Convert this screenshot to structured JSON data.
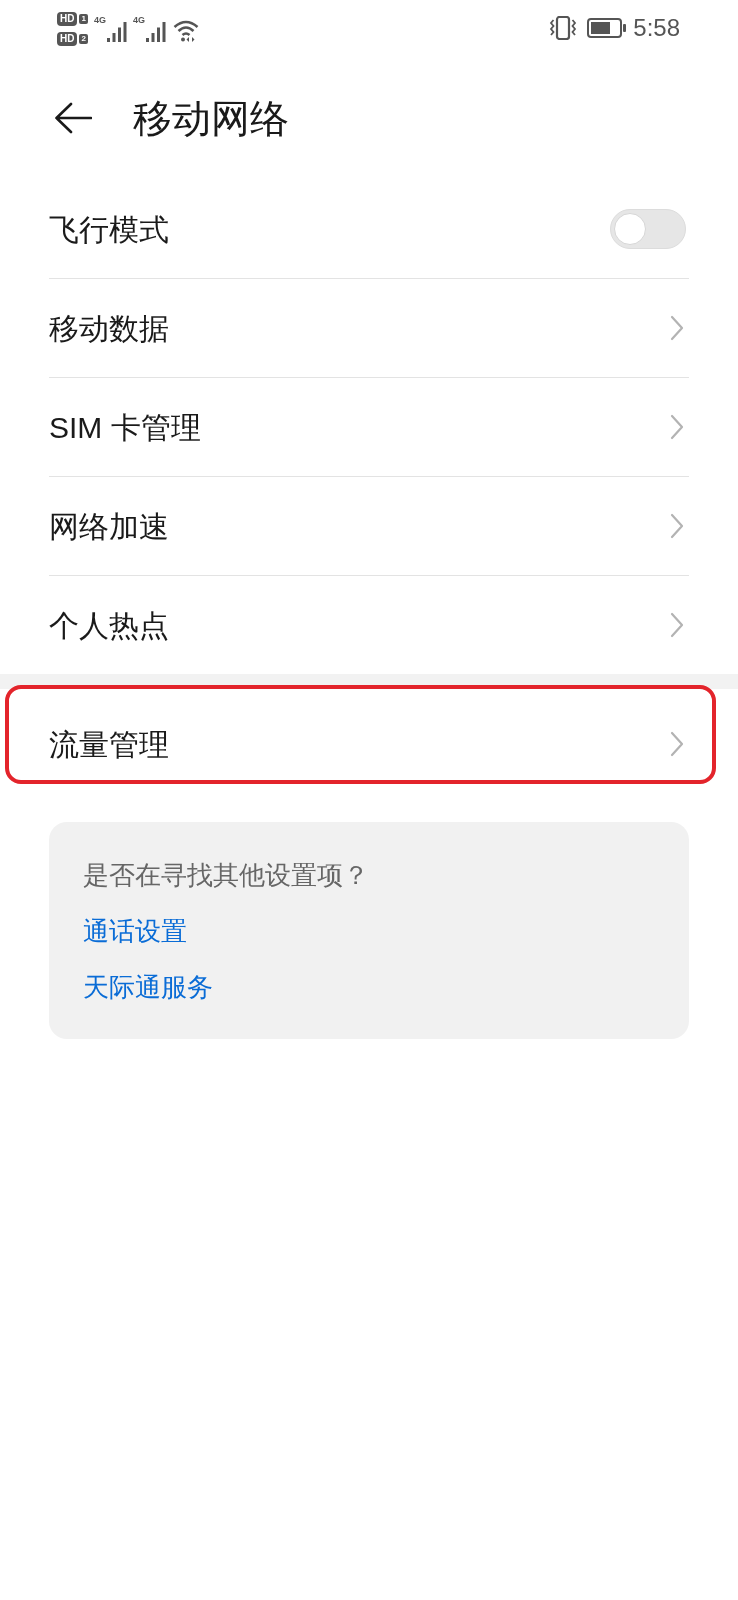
{
  "status_bar": {
    "hd_badges": [
      {
        "label": "HD",
        "slot": "1"
      },
      {
        "label": "HD",
        "slot": "2"
      }
    ],
    "signals": [
      {
        "network": "4G"
      },
      {
        "network": "4G"
      }
    ],
    "time": "5:58"
  },
  "header": {
    "title": "移动网络"
  },
  "groups": [
    {
      "items": [
        {
          "kind": "toggle",
          "label": "飞行模式",
          "on": false,
          "highlighted": false
        },
        {
          "kind": "link",
          "label": "移动数据",
          "highlighted": false
        },
        {
          "kind": "link",
          "label": "SIM 卡管理",
          "highlighted": false
        },
        {
          "kind": "link",
          "label": "网络加速",
          "highlighted": false
        },
        {
          "kind": "link",
          "label": "个人热点",
          "highlighted": false
        }
      ]
    },
    {
      "items": [
        {
          "kind": "link",
          "label": "流量管理",
          "highlighted": true
        }
      ]
    }
  ],
  "suggestions": {
    "prompt": "是否在寻找其他设置项？",
    "links": [
      "通话设置",
      "天际通服务"
    ]
  }
}
